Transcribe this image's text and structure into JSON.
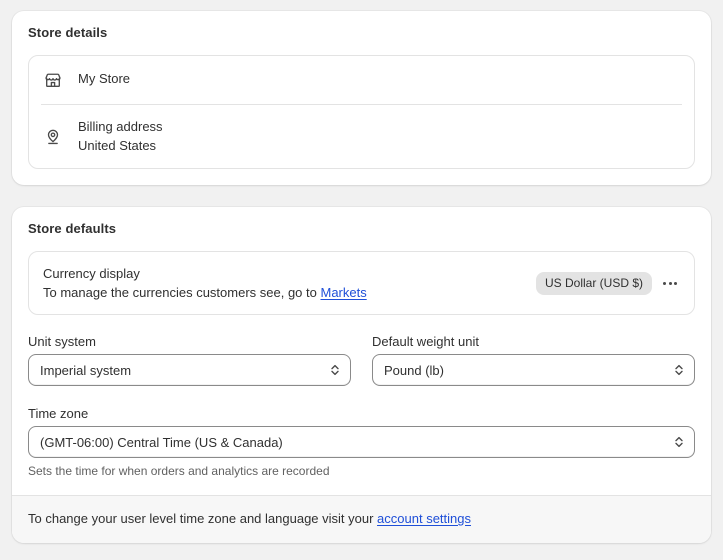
{
  "store_details": {
    "title": "Store details",
    "rows": [
      {
        "icon": "storefront-icon",
        "main": "My Store",
        "sub": ""
      },
      {
        "icon": "location-pin-icon",
        "main": "Billing address",
        "sub": "United States"
      }
    ]
  },
  "store_defaults": {
    "title": "Store defaults",
    "currency": {
      "title": "Currency display",
      "description_prefix": "To manage the currencies customers see, go to ",
      "link_label": "Markets",
      "badge": "US Dollar (USD $)",
      "menu_icon": "more-horizontal-icon"
    },
    "fields": {
      "unit_system": {
        "label": "Unit system",
        "value": "Imperial system"
      },
      "weight_unit": {
        "label": "Default weight unit",
        "value": "Pound (lb)"
      },
      "time_zone": {
        "label": "Time zone",
        "value": "(GMT-06:00) Central Time (US & Canada)",
        "helper": "Sets the time for when orders and analytics are recorded"
      }
    },
    "footer": {
      "text_prefix": "To change your user level time zone and language visit your ",
      "link_label": "account settings"
    }
  },
  "colors": {
    "page_background": "#F1F1F1",
    "card_background": "#FFFFFF",
    "text": "#303030",
    "subtle_text": "#616161",
    "border": "#E3E3E3",
    "input_border": "#8A8A8A",
    "link": "#1F4FD8",
    "badge_background": "#E3E3E3",
    "footer_background": "#F7F7F7"
  }
}
